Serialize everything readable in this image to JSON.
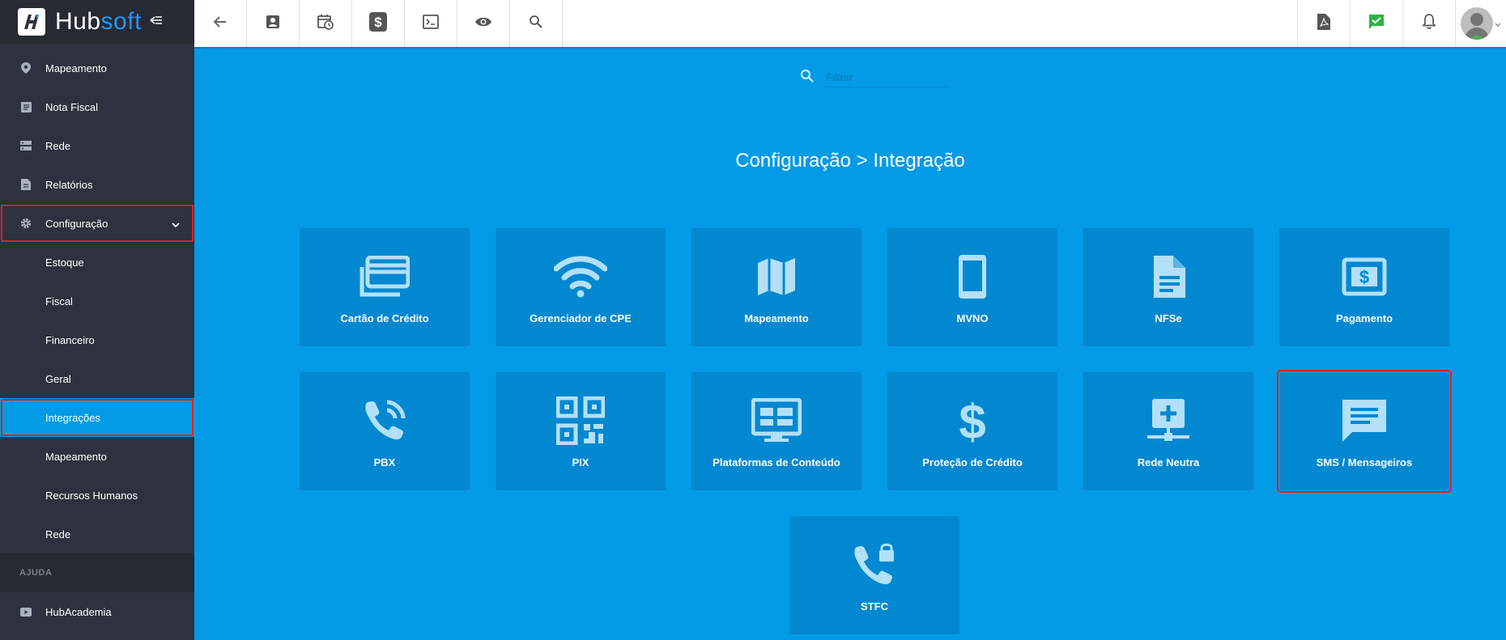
{
  "brand": {
    "name_part1": "Hub",
    "name_part2": "soft"
  },
  "sidebar": {
    "items": [
      {
        "label": "Mapeamento",
        "icon": "map-pin-icon"
      },
      {
        "label": "Nota Fiscal",
        "icon": "document-icon"
      },
      {
        "label": "Rede",
        "icon": "server-icon"
      },
      {
        "label": "Relatórios",
        "icon": "report-icon"
      },
      {
        "label": "Configuração",
        "icon": "gear-icon",
        "expanded": true
      }
    ],
    "subitems": [
      {
        "label": "Estoque"
      },
      {
        "label": "Fiscal"
      },
      {
        "label": "Financeiro"
      },
      {
        "label": "Geral"
      },
      {
        "label": "Integrações",
        "active": true
      },
      {
        "label": "Mapeamento"
      },
      {
        "label": "Recursos Humanos"
      },
      {
        "label": "Rede"
      }
    ],
    "section_help": "AJUDA",
    "help_items": [
      {
        "label": "HubAcademia",
        "icon": "play-icon"
      }
    ]
  },
  "filter": {
    "placeholder": "Filtrar"
  },
  "page_title": "Configuração > Integração",
  "tiles": [
    {
      "label": "Cartão de Crédito",
      "icon": "credit-card-icon"
    },
    {
      "label": "Gerenciador de CPE",
      "icon": "wifi-icon"
    },
    {
      "label": "Mapeamento",
      "icon": "map-icon"
    },
    {
      "label": "MVNO",
      "icon": "smartphone-icon"
    },
    {
      "label": "NFSe",
      "icon": "file-text-icon"
    },
    {
      "label": "Pagamento",
      "icon": "money-icon"
    },
    {
      "label": "PBX",
      "icon": "phone-in-talk-icon"
    },
    {
      "label": "PIX",
      "icon": "qr-code-icon"
    },
    {
      "label": "Plataformas de Conteúdo",
      "icon": "monitor-news-icon"
    },
    {
      "label": "Proteção de Crédito",
      "icon": "dollar-icon"
    },
    {
      "label": "Rede Neutra",
      "icon": "network-add-icon"
    },
    {
      "label": "SMS / Mensageiros",
      "icon": "message-icon",
      "highlighted": true
    },
    {
      "label": "STFC",
      "icon": "phone-lock-icon"
    }
  ],
  "colors": {
    "sidebar_bg": "#2d323e",
    "accent": "#039be5",
    "tile_bg": "#0288d1",
    "highlight": "#e02020"
  }
}
